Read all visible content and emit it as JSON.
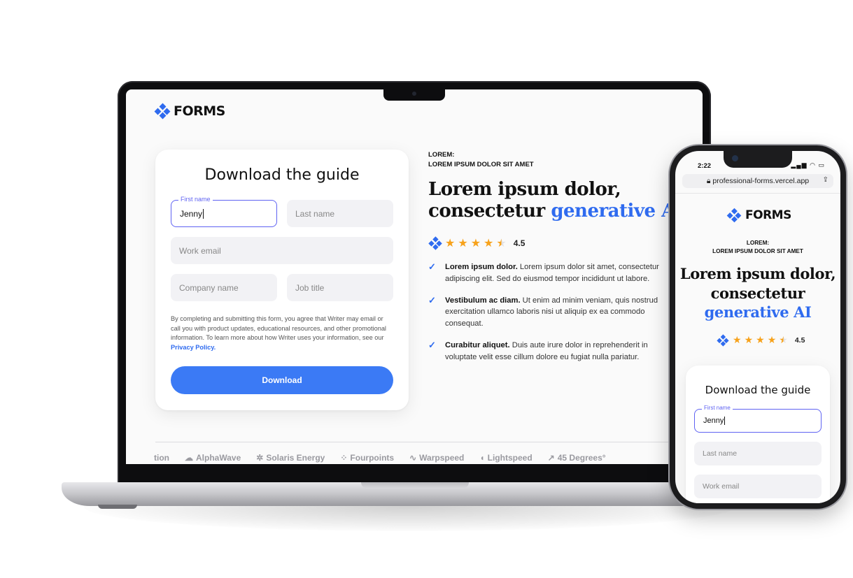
{
  "brand": {
    "name": "FORMS",
    "accent": "#2f6bef",
    "cta": "#3b7af5",
    "focus": "#5f63f2",
    "star": "#f7a21b"
  },
  "laptop": {
    "form": {
      "title": "Download the guide",
      "first_name": {
        "label": "First name",
        "value": "Jenny"
      },
      "last_name": {
        "placeholder": "Last name"
      },
      "work_email": {
        "placeholder": "Work email"
      },
      "company_name": {
        "placeholder": "Company name"
      },
      "job_title": {
        "placeholder": "Job title"
      },
      "consent_text": "By completing and submitting this form, you agree that Writer may email or call you with product updates, educational resources, and other promotional information. To learn more about how Writer uses your information, see our",
      "privacy_link": "Privacy Policy.",
      "submit_label": "Download"
    },
    "eyebrow_1": "LOREM:",
    "eyebrow_2": "LOREM IPSUM DOLOR SIT AMET",
    "headline_1": "Lorem ipsum dolor,",
    "headline_2": "consectetur",
    "headline_accent": "generative AI",
    "rating": {
      "value": "4.5",
      "stars": 4.5
    },
    "bullets": [
      {
        "bold": "Lorem ipsum dolor.",
        "text": " Lorem ipsum dolor sit amet, consectetur adipiscing elit. Sed do eiusmod tempor incididunt ut labore."
      },
      {
        "bold": "Vestibulum ac diam.",
        "text": " Ut enim ad minim veniam, quis nostrud exercitation ullamco laboris nisi ut aliquip ex ea commodo consequat."
      },
      {
        "bold": "Curabitur aliquet.",
        "text": " Duis aute irure dolor in reprehenderit in voluptate velit esse cillum dolore eu fugiat nulla pariatur."
      }
    ],
    "customer_logos": [
      "tion",
      "AlphaWave",
      "Solaris Energy",
      "Fourpoints",
      "Warpspeed",
      "Lightspeed",
      "45 Degrees°"
    ]
  },
  "phone": {
    "time": "2:22",
    "url": "professional-forms.vercel.app",
    "eyebrow_1": "LOREM:",
    "eyebrow_2": "LOREM IPSUM DOLOR SIT AMET",
    "headline_1": "Lorem ipsum dolor,",
    "headline_2": "consectetur",
    "headline_accent": "generative AI",
    "rating": {
      "value": "4.5",
      "stars": 4.5
    },
    "form": {
      "title": "Download the guide",
      "first_name": {
        "label": "First name",
        "value": "Jenny"
      },
      "last_name": {
        "placeholder": "Last name"
      },
      "work_email": {
        "placeholder": "Work email"
      }
    }
  }
}
